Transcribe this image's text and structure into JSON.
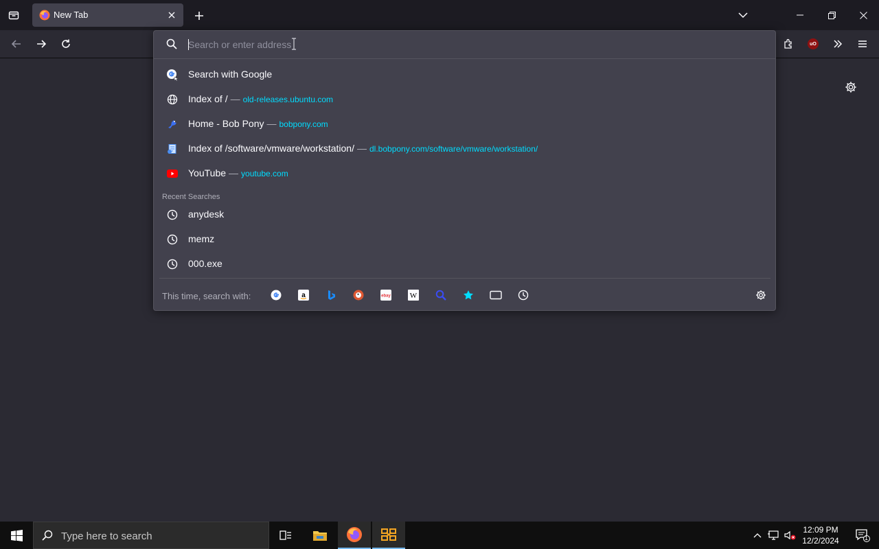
{
  "window": {
    "tab": {
      "title": "New Tab",
      "close_icon": "close-icon"
    },
    "newtab_icon": "plus-icon",
    "list_tabs_icon": "chevron-down-icon",
    "controls": [
      "minimize-icon",
      "restore-icon",
      "close-icon"
    ]
  },
  "urlbar": {
    "placeholder": "Search or enter address",
    "results": [
      {
        "icon": "google-icon",
        "title": "Search with Google",
        "url": ""
      },
      {
        "icon": "globe-icon",
        "title": "Index of /",
        "sep": "—",
        "url": "old-releases.ubuntu.com"
      },
      {
        "icon": "bobpony-icon",
        "title": "Home - Bob Pony",
        "sep": "—",
        "url": "bobpony.com"
      },
      {
        "icon": "doc-icon",
        "title": "Index of /software/vmware/workstation/",
        "sep": "—",
        "url": "dl.bobpony.com/software/vmware/workstation/"
      },
      {
        "icon": "youtube-icon",
        "title": "YouTube",
        "sep": "—",
        "url": "youtube.com"
      }
    ],
    "recent_label": "Recent Searches",
    "recent": [
      "anydesk",
      "memz",
      "000.exe"
    ],
    "footer_label": "This time, search with:",
    "engines": [
      "google-icon",
      "amazon-icon",
      "bing-icon",
      "duckduckgo-icon",
      "ebay-icon",
      "wikipedia-icon",
      "search-icon",
      "bookmarks-icon",
      "tabs-icon",
      "history-icon"
    ]
  },
  "taskbar": {
    "search_placeholder": "Type here to search",
    "time": "12:09 PM",
    "date": "12/2/2024",
    "notifications": "1"
  }
}
